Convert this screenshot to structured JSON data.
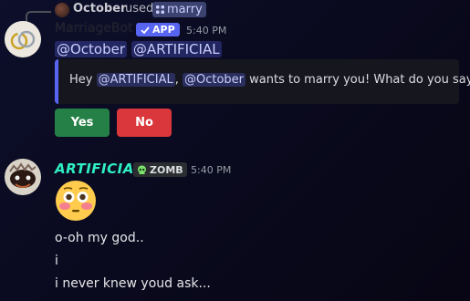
{
  "reply": {
    "username": "October",
    "used_text": "used",
    "command": "marry"
  },
  "bot_message": {
    "username": "MarriageBot",
    "badge": "APP",
    "timestamp": "5:40 PM",
    "mentions": [
      "@October",
      "@ARTIFICIAL"
    ],
    "embed": {
      "prefix": "Hey ",
      "mention1": "@ARTIFICIAL",
      "mid": ", ",
      "mention2": "@October",
      "suffix": " wants to marry you! What do you say?"
    },
    "buttons": {
      "yes": "Yes",
      "no": "No"
    }
  },
  "user_message": {
    "username": "ARTIFICIAL",
    "tag": "ZOMB",
    "timestamp": "5:40 PM",
    "emoji": "flushed-face",
    "lines": [
      "o-oh my god..",
      "i",
      "i never knew youd ask..."
    ]
  },
  "colors": {
    "blurple": "#5865f2",
    "yes_green": "#248046",
    "no_red": "#da373c",
    "artificial_name": "#2ff0c2"
  }
}
